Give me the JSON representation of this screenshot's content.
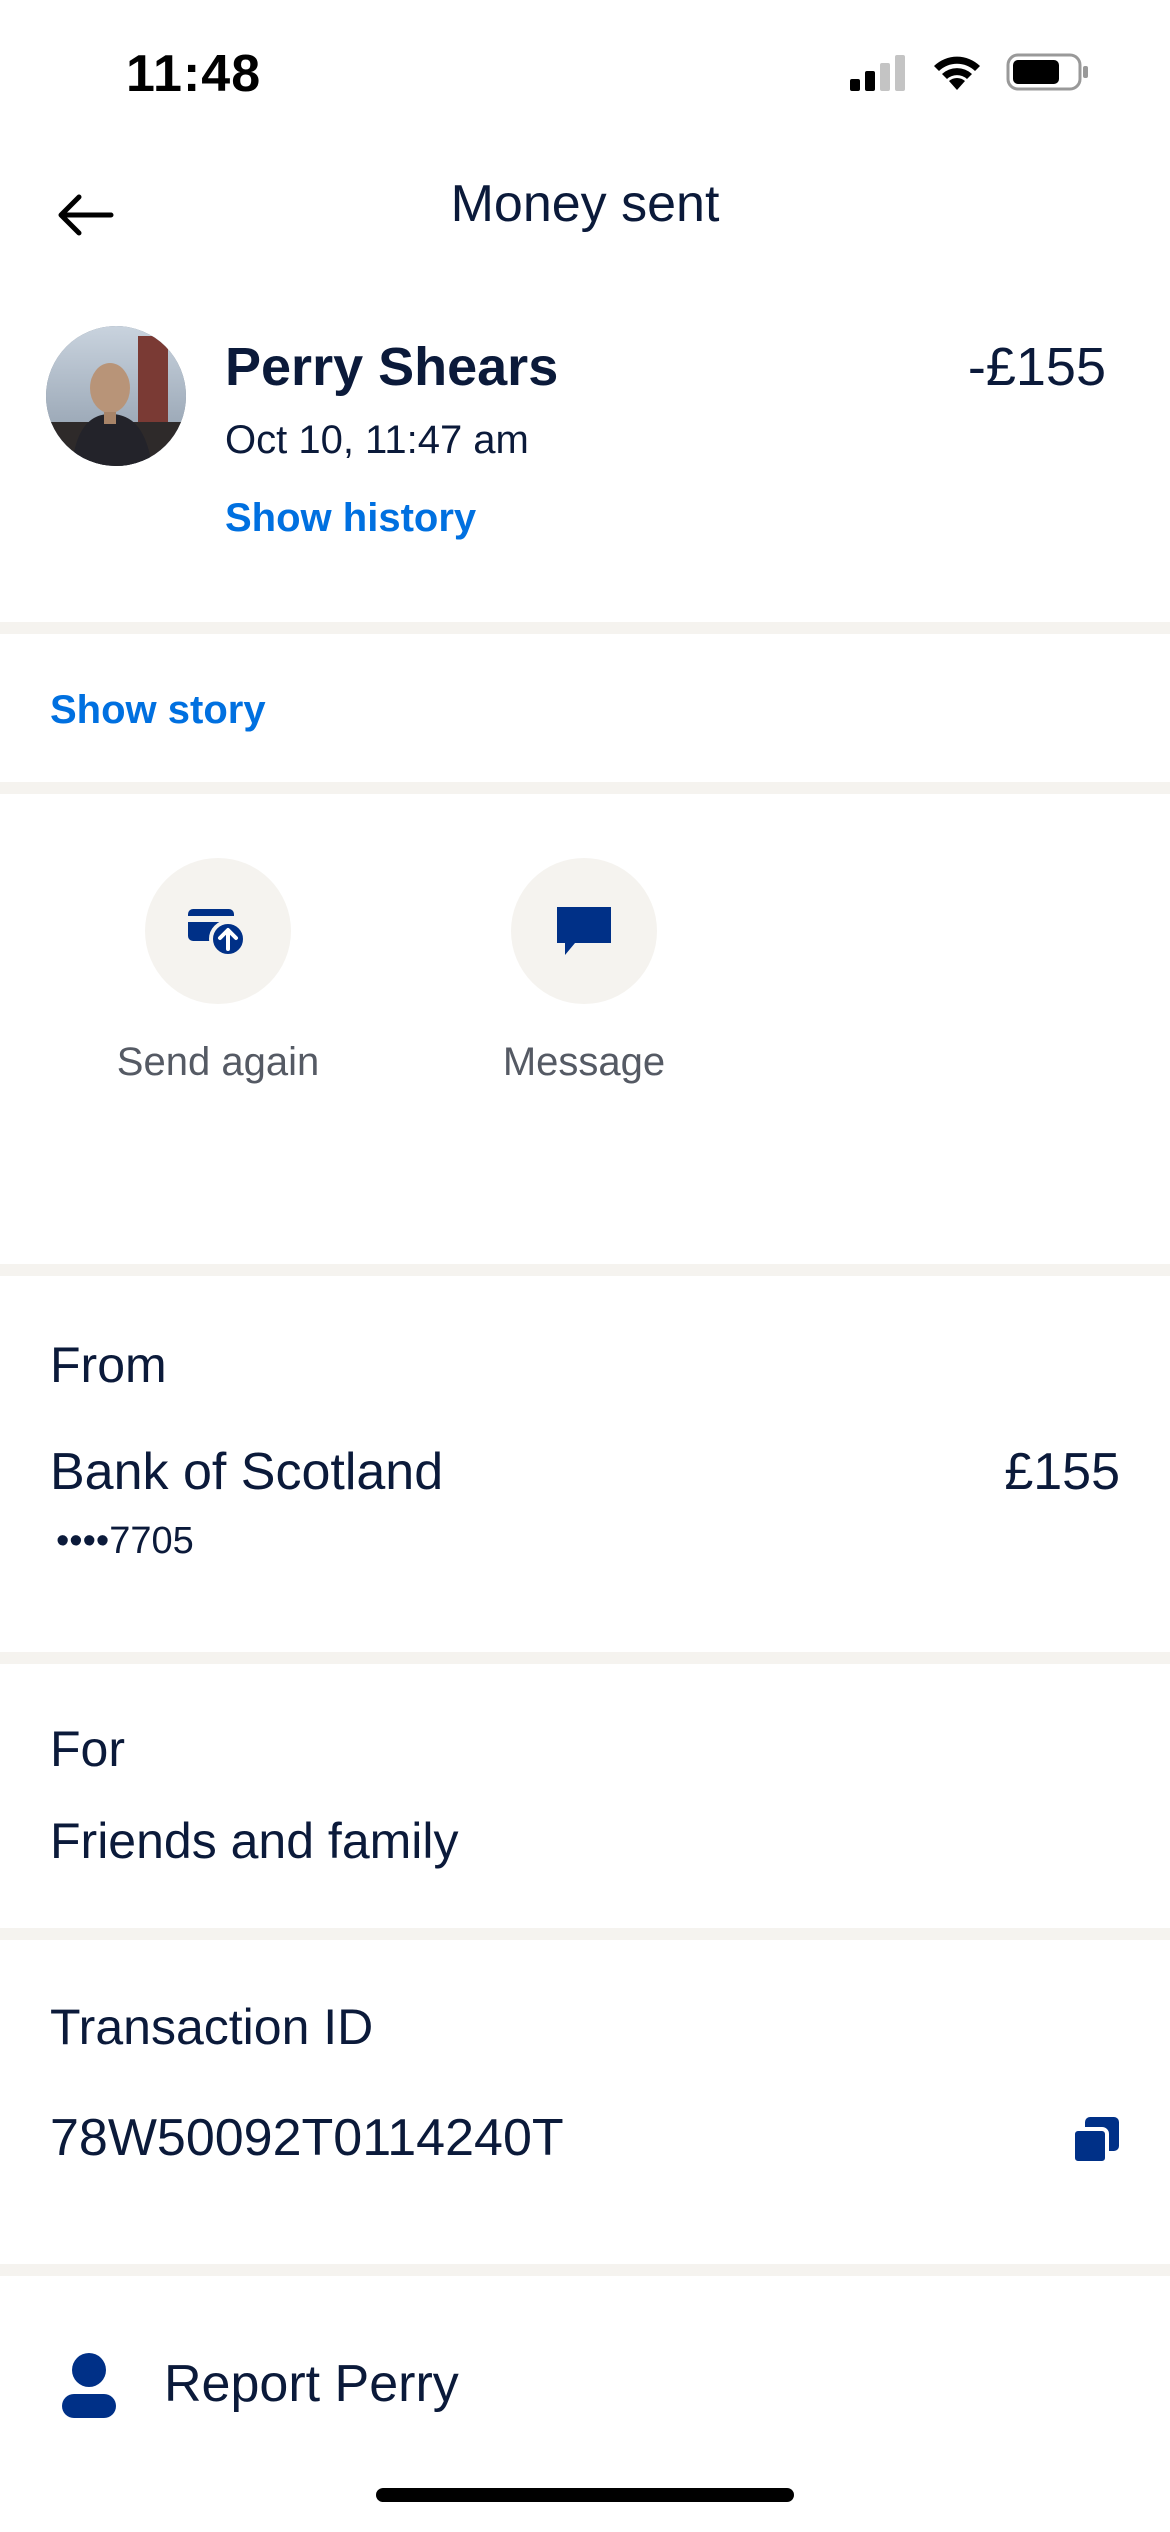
{
  "status_bar": {
    "time": "11:48",
    "icons": [
      "cellular-signal-icon",
      "wifi-icon",
      "battery-icon"
    ]
  },
  "header": {
    "title": "Money sent",
    "back_icon": "arrow-left-icon"
  },
  "transaction": {
    "contact_name": "Perry Shears",
    "amount": "-£155",
    "date": "Oct 10, 11:47 am",
    "show_history_label": "Show history"
  },
  "story": {
    "label": "Show story"
  },
  "actions": [
    {
      "label": "Send again",
      "icon": "send-again-icon"
    },
    {
      "label": "Message",
      "icon": "message-icon"
    }
  ],
  "from_section": {
    "label": "From",
    "bank_name": "Bank of Scotland",
    "account_mask": "••••7705",
    "amount": "£155"
  },
  "for_section": {
    "label": "For",
    "value": "Friends and family"
  },
  "transaction_id_section": {
    "label": "Transaction ID",
    "value": "78W50092T0114240T",
    "copy_icon": "copy-icon"
  },
  "report": {
    "label": "Report Perry",
    "icon": "person-icon"
  },
  "colors": {
    "primary_text": "#0b1a3a",
    "link_blue": "#0070e0",
    "icon_navy": "#003087",
    "divider": "#f5f3ef"
  }
}
